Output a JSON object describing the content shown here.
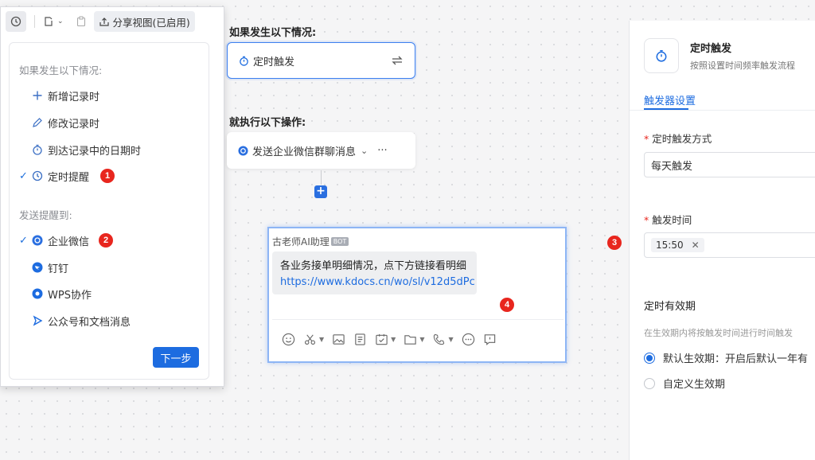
{
  "toolbar": {
    "share_label": "分享视图(已启用)"
  },
  "popover": {
    "section_trigger": "如果发生以下情况:",
    "triggers": [
      {
        "label": "新增记录时",
        "icon": "plus-icon",
        "checked": false
      },
      {
        "label": "修改记录时",
        "icon": "pencil-icon",
        "checked": false
      },
      {
        "label": "到达记录中的日期时",
        "icon": "timer-icon",
        "checked": false
      },
      {
        "label": "定时提醒",
        "icon": "clock-icon",
        "checked": true,
        "badge": "1"
      }
    ],
    "section_send": "发送提醒到:",
    "targets": [
      {
        "label": "企业微信",
        "icon": "wecom-icon",
        "checked": true,
        "badge": "2",
        "color": "#2a6fe0"
      },
      {
        "label": "钉钉",
        "icon": "dingtalk-icon",
        "checked": false,
        "color": "#1d6ce0"
      },
      {
        "label": "WPS协作",
        "icon": "wps-icon",
        "checked": false,
        "color": "#1d6ce0"
      },
      {
        "label": "公众号和文档消息",
        "icon": "send-icon",
        "checked": false,
        "color": "#1d6ce0"
      }
    ],
    "next_label": "下一步"
  },
  "canvas": {
    "if_label": "如果发生以下情况:",
    "trigger_card": "定时触发",
    "then_label": "就执行以下操作:",
    "action_card": "发送企业微信群聊消息",
    "more": "···",
    "add": "+"
  },
  "chat": {
    "sender": "古老师AI助理",
    "bot_tag": "BOT",
    "message": "各业务接单明细情况，点下方链接看明细",
    "link": "https://www.kdocs.cn/wo/sl/v12d5dPc",
    "badge": "4",
    "tools": [
      "emoji-icon",
      "scissors-icon",
      "image-icon",
      "doc-icon",
      "calendar-icon",
      "folder-icon",
      "phone-icon",
      "more-icon",
      "chat-record-icon"
    ]
  },
  "panel_badge": "3",
  "panel": {
    "title": "定时触发",
    "subtitle": "按照设置时间频率触发流程",
    "tab": "触发器设置",
    "mode_label": "定时触发方式",
    "mode_value": "每天触发",
    "time_label": "触发时间",
    "time_value": "15:50",
    "validity_title": "定时有效期",
    "validity_hint": "在生效期内将按触发时间进行时间触发",
    "option_default": "默认生效期：开启后默认一年有",
    "option_custom": "自定义生效期"
  },
  "colors": {
    "accent": "#1d6ce0",
    "badge": "#e8261e"
  }
}
